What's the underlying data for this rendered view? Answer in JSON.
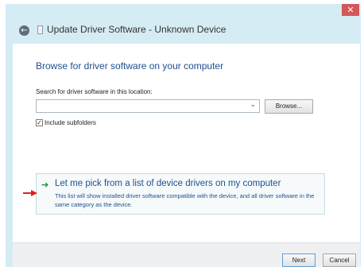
{
  "window": {
    "title": "Update Driver Software - Unknown Device",
    "close_glyph": "✕"
  },
  "main": {
    "heading": "Browse for driver software on your computer",
    "search_label": "Search for driver software in this location:",
    "path_value": "",
    "browse_label": "Browse...",
    "include_subfolders_label": "Include subfolders",
    "include_subfolders_checked": true
  },
  "pick_option": {
    "title": "Let me pick from a list of device drivers on my computer",
    "description": "This list will show installed driver software compatible with the device, and all driver software in the same category as the device."
  },
  "footer": {
    "next_label": "Next",
    "cancel_label": "Cancel"
  },
  "icons": {
    "back": "back-arrow-icon",
    "device": "device-icon",
    "dropdown": "chevron-down-icon",
    "option_arrow": "green-arrow-icon",
    "pointer": "red-arrow-icon"
  },
  "colors": {
    "frame": "#d5ecf5",
    "close": "#d3585a",
    "heading_blue": "#1f4f90",
    "green_arrow": "#1c8a3a",
    "red_arrow": "#e02020"
  }
}
